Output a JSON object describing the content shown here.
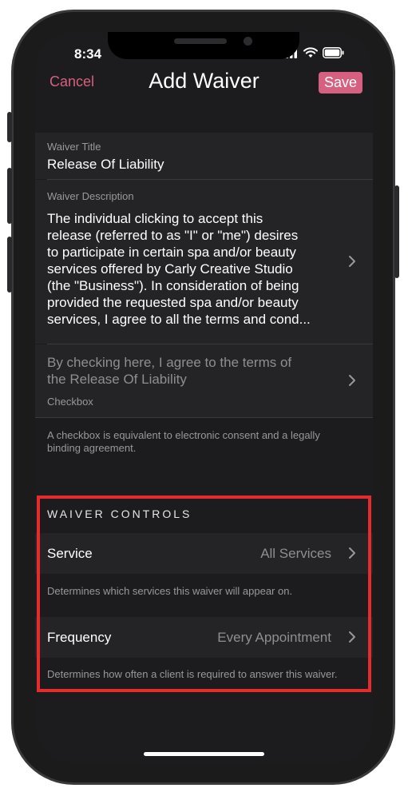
{
  "status": {
    "time": "8:34"
  },
  "nav": {
    "cancel_label": "Cancel",
    "title": "Add Waiver",
    "save_label": "Save"
  },
  "waiver_title": {
    "label": "Waiver Title",
    "value": "Release Of Liability"
  },
  "waiver_description": {
    "label": "Waiver Description",
    "lines": [
      "The individual clicking to accept this",
      "release (referred to as \"I\" or \"me\") desires",
      "to participate in certain spa and/or beauty",
      "services offered by Carly Creative Studio",
      "(the \"Business\"). In consideration of being",
      "provided the requested spa and/or beauty",
      "services, I agree to all the terms and cond..."
    ]
  },
  "consent": {
    "lines": [
      "By checking here, I agree to the terms of",
      "the Release Of Liability"
    ],
    "type_label": "Checkbox",
    "footer_lines": [
      "A checkbox is equivalent to electronic consent and a legally",
      "binding agreement."
    ]
  },
  "waiver_controls": {
    "header": "WAIVER CONTROLS",
    "service": {
      "label": "Service",
      "value": "All Services",
      "note": "Determines which services this waiver will appear on."
    },
    "frequency": {
      "label": "Frequency",
      "value": "Every Appointment",
      "note": "Determines how often a client is required to answer this waiver."
    }
  },
  "colors": {
    "accent": "#d6607f",
    "highlight_border": "#e52b2b",
    "background": "#1c1c1e",
    "cell_background": "#242426"
  },
  "icons": [
    "signal-icon",
    "wifi-icon",
    "battery-icon",
    "chevron-right-icon"
  ]
}
